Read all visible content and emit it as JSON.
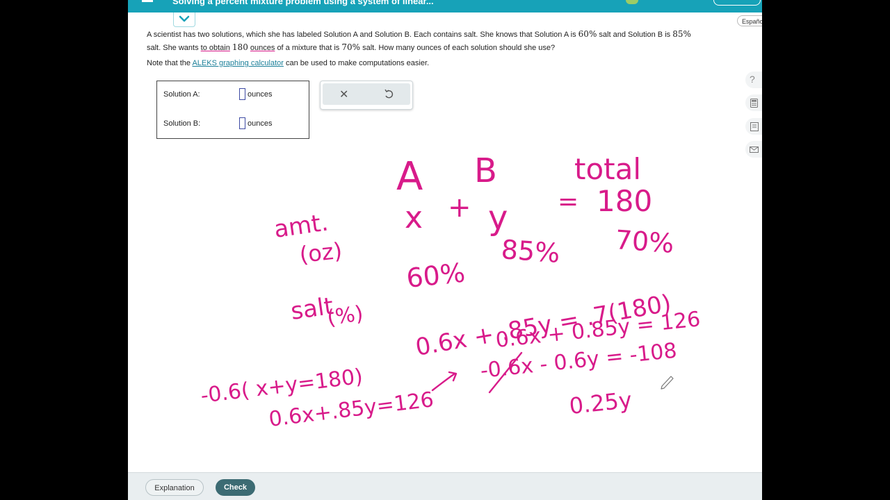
{
  "header": {
    "title": "Solving a percent mixture problem using a system of linear..."
  },
  "language_link": "Español",
  "problem": {
    "p1": "A scientist has two solutions, which she has labeled Solution A and Solution B. Each contains salt. She knows that Solution A is",
    "pctA": "60%",
    "p2": "salt and Solution B is",
    "pctB": "85%",
    "p3": "salt. She wants",
    "obtain": "to obtain",
    "amount": "180",
    "ounces": "ounces",
    "p4": "of a mixture that is",
    "pctMix": "70%",
    "p5": "salt. How many ounces of each solution should she use?",
    "note_prefix": "Note that the",
    "note_link": "ALEKS graphing calculator",
    "note_suffix": "can be used to make computations easier."
  },
  "answers": [
    {
      "label": "Solution A:",
      "value": "",
      "unit": "ounces"
    },
    {
      "label": "Solution B:",
      "value": "",
      "unit": "ounces"
    }
  ],
  "tools": {
    "clear_icon": "close-icon",
    "undo_icon": "undo-icon"
  },
  "side_icons": [
    "help-icon",
    "calculator-icon",
    "dictionary-icon",
    "mail-icon"
  ],
  "side_labels": {
    "help": "?"
  },
  "footer": {
    "explanation_label": "Explanation",
    "check_label": "Check"
  },
  "handwriting": {
    "hdr_a": "A",
    "hdr_b": "B",
    "hdr_total": "total",
    "row1_label": "amt.",
    "row1_unit": "(oz)",
    "row1_x": "x",
    "row1_plus": "+",
    "row1_y": "y",
    "row1_eq": "=",
    "row1_total": "180",
    "row2_label": "salt",
    "row2_unit": "(%)",
    "row2_a": "60%",
    "row2_b": "85%",
    "row2_total": "70%",
    "eq_salt": "0.6x + .85y = .7(180)",
    "eq_sys1": "-0.6(  x+y=180)",
    "eq_sys2": "0.6x+.85y=126",
    "eq_sum1": "0.6x + 0.85y = 126",
    "eq_sum2": "-0.6x - 0.6y = -108",
    "eq_result": "0.25y"
  },
  "colors": {
    "ink": "#d81b8a",
    "topbar": "#17a2b8",
    "check_button": "#3c6b73"
  }
}
